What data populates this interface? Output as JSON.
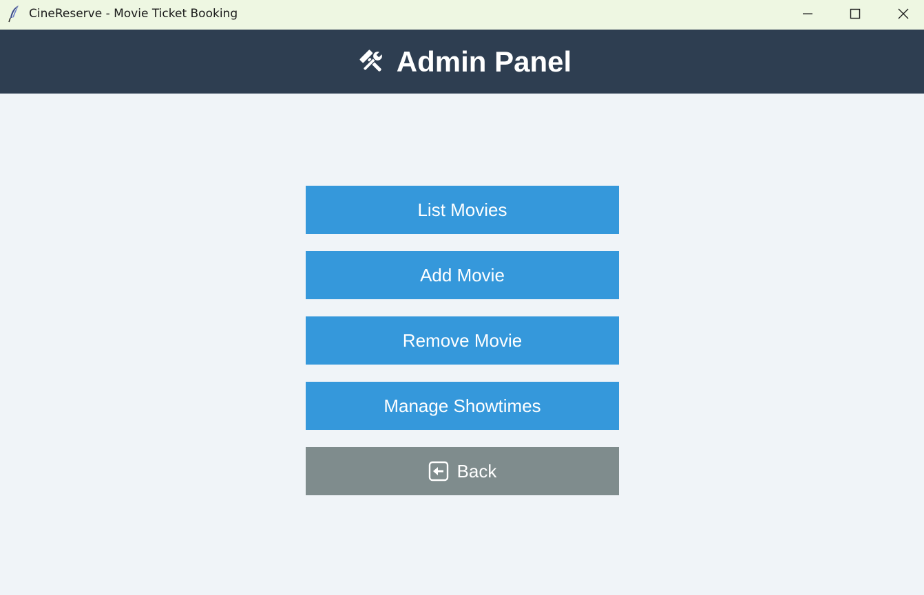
{
  "window": {
    "title": "CineReserve - Movie Ticket Booking",
    "app_icon": "feather-icon",
    "controls": [
      "minimize-icon",
      "maximize-icon",
      "close-icon"
    ]
  },
  "header": {
    "icon": "tools-icon",
    "title": "Admin Panel",
    "background": "#2e3e51"
  },
  "menu": {
    "button_color": "#3598db",
    "back_color": "#7f8c8d",
    "items": [
      {
        "label": "List Movies"
      },
      {
        "label": "Add Movie"
      },
      {
        "label": "Remove Movie"
      },
      {
        "label": "Manage Showtimes"
      }
    ],
    "back": {
      "label": "Back",
      "icon": "back-arrow-icon"
    }
  },
  "colors": {
    "page_background": "#f0f4f8",
    "titlebar_background": "#eef7e2"
  }
}
